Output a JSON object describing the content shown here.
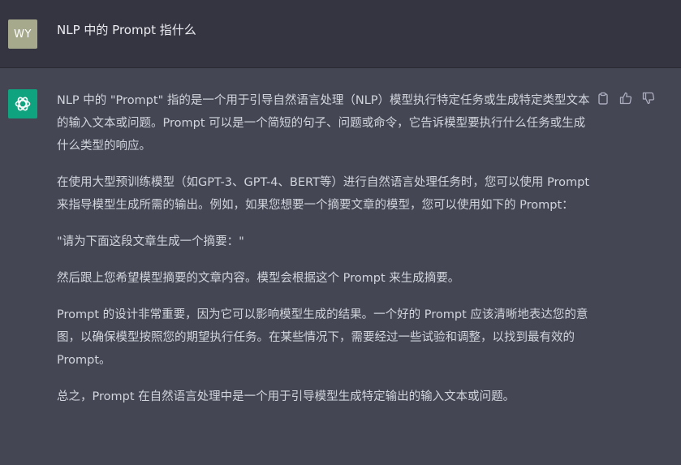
{
  "user": {
    "avatar_initials": "WY",
    "message": "NLP 中的 Prompt 指什么"
  },
  "assistant": {
    "paragraphs": [
      "NLP 中的 \"Prompt\" 指的是一个用于引导自然语言处理（NLP）模型执行特定任务或生成特定类型文本的输入文本或问题。Prompt 可以是一个简短的句子、问题或命令，它告诉模型要执行什么任务或生成什么类型的响应。",
      "在使用大型预训练模型（如GPT-3、GPT-4、BERT等）进行自然语言处理任务时，您可以使用 Prompt 来指导模型生成所需的输出。例如，如果您想要一个摘要文章的模型，您可以使用如下的 Prompt：",
      "\"请为下面这段文章生成一个摘要：\"",
      "然后跟上您希望模型摘要的文章内容。模型会根据这个 Prompt 来生成摘要。",
      "Prompt 的设计非常重要，因为它可以影响模型生成的结果。一个好的 Prompt 应该清晰地表达您的意图，以确保模型按照您的期望执行任务。在某些情况下，需要经过一些试验和调整，以找到最有效的 Prompt。",
      "总之，Prompt 在自然语言处理中是一个用于引导模型生成特定输出的输入文本或问题。"
    ],
    "actions": [
      "copy-icon",
      "thumbs-up-icon",
      "thumbs-down-icon"
    ]
  },
  "colors": {
    "user_row_bg": "#343541",
    "assistant_row_bg": "#444654",
    "assistant_avatar_bg": "#10a37f",
    "user_avatar_bg": "#a7a98d",
    "text": "#d1d5db"
  }
}
